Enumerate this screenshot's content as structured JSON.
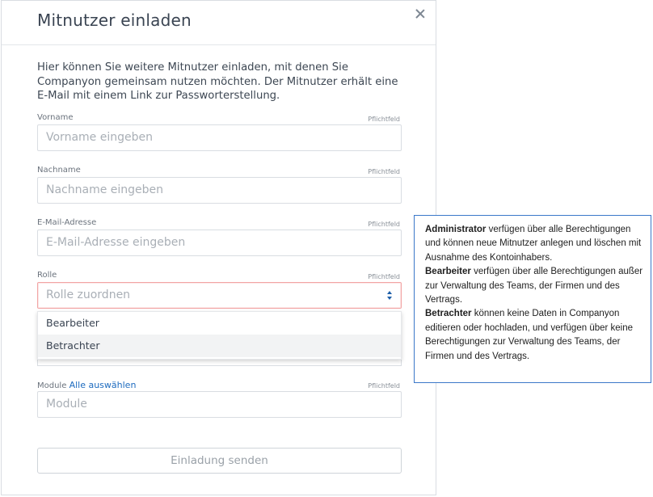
{
  "dialog": {
    "title": "Mitnutzer einladen",
    "intro": "Hier können Sie weitere Mitnutzer einladen, mit denen Sie Companyon gemeinsam nutzen möchten. Der Mitnutzer erhält eine E-Mail mit einem Link zur Passworterstellung.",
    "required_label": "Pflichtfeld",
    "fields": {
      "vorname": {
        "label": "Vorname",
        "placeholder": "Vorname eingeben"
      },
      "nachname": {
        "label": "Nachname",
        "placeholder": "Nachname eingeben"
      },
      "email": {
        "label": "E-Mail-Adresse",
        "placeholder": "E-Mail-Adresse eingeben"
      },
      "rolle": {
        "label": "Rolle",
        "placeholder": "Rolle zuordnen",
        "options": [
          "Bearbeiter",
          "Betrachter"
        ],
        "highlighted_option": "Betrachter"
      },
      "module": {
        "label": "Module",
        "select_all": "Alle auswählen",
        "placeholder": "Module"
      }
    },
    "submit_label": "Einladung senden"
  },
  "tooltip": {
    "admin_term": "Administrator",
    "admin_text": " verfügen über alle Berechtigungen und können neue Mitnutzer anlegen und löschen mit Ausnahme des Kontoinhabers.",
    "editor_term": "Bearbeiter",
    "editor_text": " verfügen über alle Berechtigungen außer zur Verwaltung des Teams, der Firmen und des Vertrags.",
    "viewer_term": "Betrachter",
    "viewer_text": " können keine Daten in Companyon editieren oder hochladen, und verfügen über keine Berechtigungen zur Verwaltung des Teams, der Firmen und des Vertrags."
  },
  "colors": {
    "accent": "#1d6bbf",
    "tooltip_border": "#3b78c9",
    "error_border": "#f2a4a4"
  }
}
